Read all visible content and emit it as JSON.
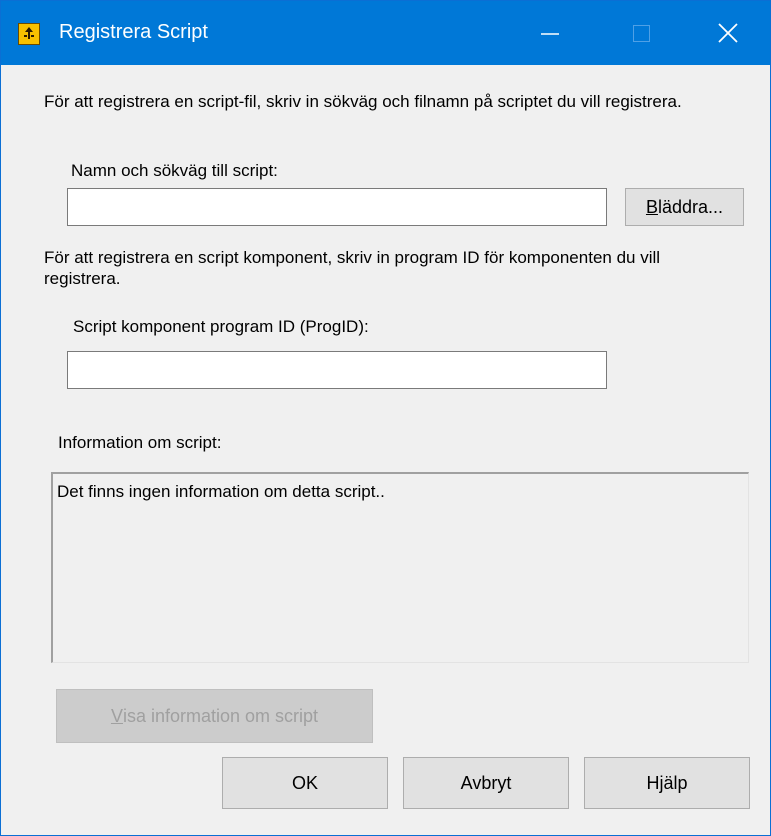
{
  "window": {
    "title": "Registrera Script",
    "accent": "#0078d7",
    "icons": {
      "app": "script-icon",
      "minimize": "minimize-icon",
      "maximize": "maximize-icon",
      "close": "close-icon"
    }
  },
  "script_file": {
    "instructions": "För att registrera en script-fil, skriv in sökväg och filnamn på scriptet du vill registrera.",
    "label": "Namn och sökväg till script:",
    "value": "",
    "browse_button": {
      "accel": "B",
      "rest": "läddra..."
    }
  },
  "component": {
    "instructions": "För att registrera en script komponent, skriv in program ID för komponenten du vill registrera.",
    "label": "Script komponent program ID (ProgID):",
    "value": ""
  },
  "info": {
    "label": "Information om script:",
    "text": "Det finns ingen information om detta script..",
    "show_button": {
      "accel": "V",
      "rest": "isa information om script"
    }
  },
  "buttons": {
    "ok": "OK",
    "cancel": "Avbryt",
    "help": "Hjälp"
  }
}
